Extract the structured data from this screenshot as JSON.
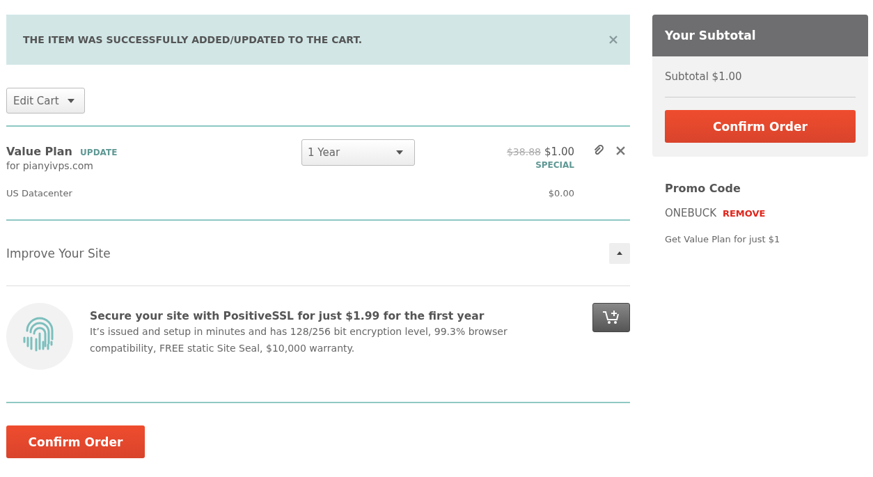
{
  "alert": {
    "message": "THE ITEM WAS SUCCESSFULLY ADDED/UPDATED TO THE CART."
  },
  "edit_cart": {
    "label": "Edit Cart"
  },
  "cart_items": [
    {
      "name": "Value Plan",
      "action": "UPDATE",
      "domain": "for pianyivps.com",
      "term": "1 Year",
      "old_price": "$38.88",
      "price": "$1.00",
      "tag": "SPECIAL",
      "addon": "US Datacenter",
      "addon_price": "$0.00"
    }
  ],
  "improve": {
    "title": "Improve Your Site",
    "expanded": true,
    "offers": [
      {
        "title": "Secure your site with PositiveSSL for just $1.99 for the first year",
        "description": "It’s issued and setup in minutes and has 128/256 bit encryption level, 99.3% browser compatibility, FREE static Site Seal, $10,000 warranty."
      }
    ]
  },
  "confirm_bottom": "Confirm Order",
  "summary": {
    "title": "Your Subtotal",
    "subtotal": "Subtotal $1.00",
    "confirm": "Confirm Order"
  },
  "promo": {
    "title": "Promo Code",
    "code": "ONEBUCK",
    "remove": "REMOVE",
    "note": "Get Value Plan for just $1"
  }
}
